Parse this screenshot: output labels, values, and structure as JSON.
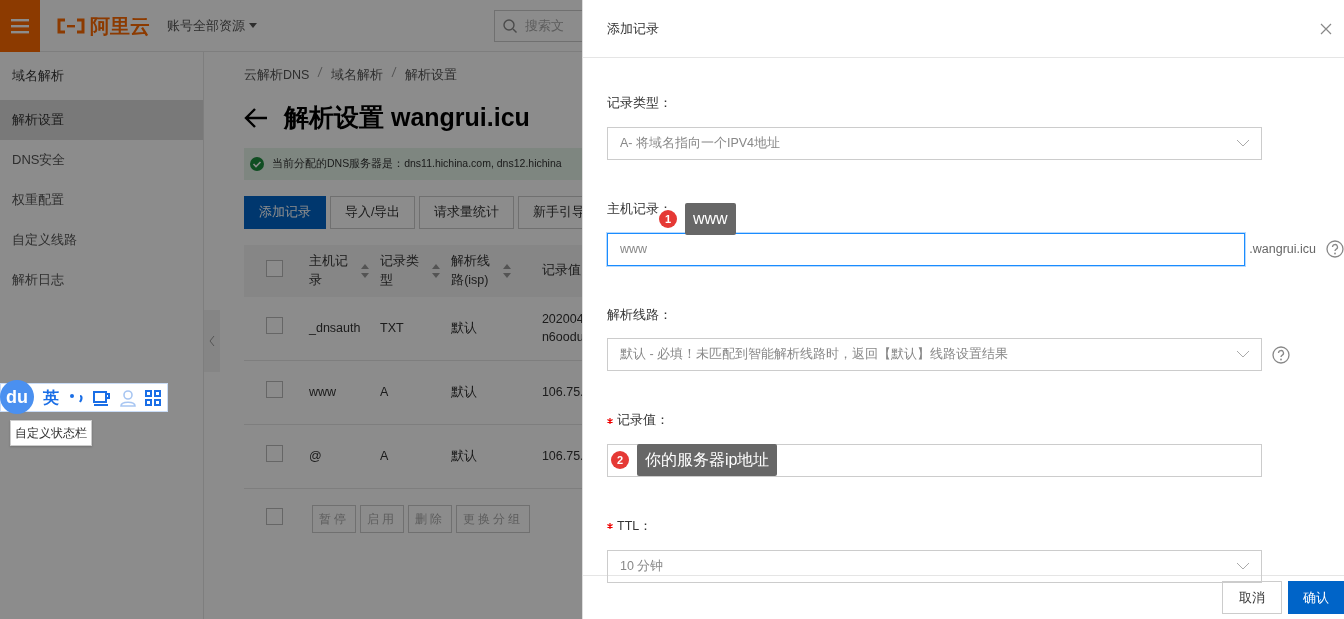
{
  "header": {
    "brand": "阿里云",
    "account_menu": "账号全部资源",
    "search_placeholder": "搜索文"
  },
  "sidebar": {
    "title": "域名解析",
    "items": [
      {
        "label": "解析设置",
        "selected": true
      },
      {
        "label": "DNS安全",
        "selected": false
      },
      {
        "label": "权重配置",
        "selected": false
      },
      {
        "label": "自定义线路",
        "selected": false
      },
      {
        "label": "解析日志",
        "selected": false
      }
    ]
  },
  "breadcrumb": [
    "云解析DNS",
    "域名解析",
    "解析设置"
  ],
  "page_title": "解析设置 wangrui.icu",
  "alert": "当前分配的DNS服务器是：dns11.hichina.com, dns12.hichina",
  "toolbar": [
    {
      "label": "添加记录",
      "primary": true
    },
    {
      "label": "导入/导出",
      "primary": false
    },
    {
      "label": "请求量统计",
      "primary": false
    },
    {
      "label": "新手引导",
      "primary": false
    }
  ],
  "table": {
    "columns": [
      "主机记录",
      "记录类型",
      "解析线路(isp)",
      "记录值"
    ],
    "rows": [
      {
        "checked": false,
        "cells": [
          "_dnsauth",
          "TXT",
          "默认",
          "202004 n6oodu"
        ]
      },
      {
        "checked": false,
        "cells": [
          "www",
          "A",
          "默认",
          "106.75."
        ]
      },
      {
        "checked": false,
        "cells": [
          "@",
          "A",
          "默认",
          "106.75."
        ]
      }
    ],
    "header_checked": false,
    "footer_checked": false,
    "footer_buttons": [
      {
        "label": "暂停",
        "disabled": true
      },
      {
        "label": "启用",
        "disabled": true
      },
      {
        "label": "删除",
        "disabled": true
      },
      {
        "label": "更换分组",
        "disabled": true
      }
    ]
  },
  "ime_bar": {
    "logo": "du",
    "mode": "英",
    "tooltip": "自定义状态栏"
  },
  "dialog": {
    "title": "添加记录",
    "fields": [
      {
        "kind": "select",
        "label": "记录类型：",
        "required": false,
        "value": "A- 将域名指向一个IPV4地址",
        "help": false
      },
      {
        "kind": "input",
        "label": "主机记录：",
        "required": false,
        "value": "www",
        "focused": true,
        "suffix": ".wangrui.icu",
        "help": true,
        "annotation": {
          "number": "1",
          "text": "www"
        }
      },
      {
        "kind": "select",
        "label": "解析线路：",
        "required": false,
        "value": "默认 - 必填！未匹配到智能解析线路时，返回【默认】线路设置结果",
        "help": true
      },
      {
        "kind": "input",
        "label": "记录值：",
        "required": true,
        "focused": false,
        "help": false,
        "annotation": {
          "number": "2",
          "text": "你的服务器ip地址"
        }
      },
      {
        "kind": "select",
        "label": "TTL：",
        "required": true,
        "value": "10 分钟",
        "help": false
      }
    ],
    "cancel": "取消",
    "confirm": "确认"
  }
}
